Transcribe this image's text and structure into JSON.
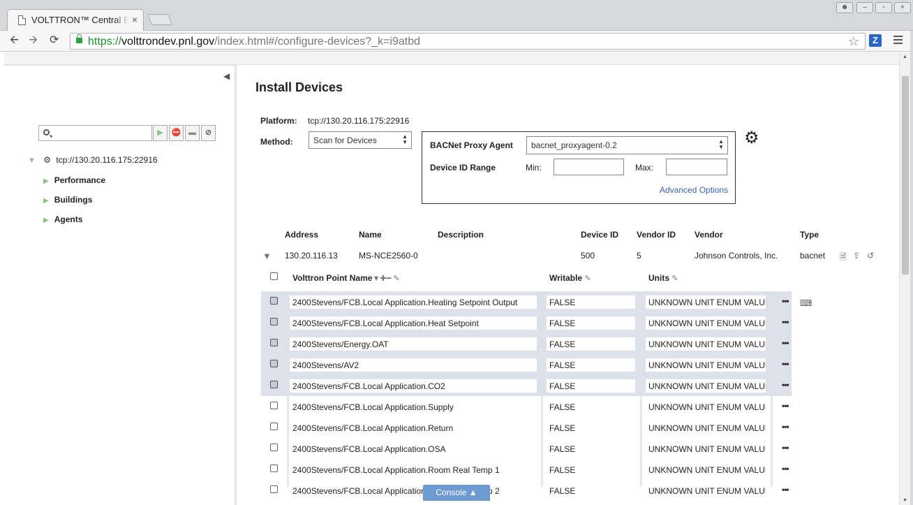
{
  "browser": {
    "tab_title": "VOLTTRON™ Central BETA",
    "url_scheme": "https://",
    "url_host": "volttrondev.pnl.gov",
    "url_path": "/index.html#/configure-devices?_k=i9atbd",
    "extension_label": "Z"
  },
  "sidebar": {
    "search_placeholder": "",
    "root_label": "tcp://130.20.116.175:22916",
    "items": [
      {
        "label": "Performance"
      },
      {
        "label": "Buildings"
      },
      {
        "label": "Agents"
      }
    ]
  },
  "main": {
    "title": "Install Devices",
    "platform_label": "Platform:",
    "platform_value": "tcp://130.20.116.175:22916",
    "method_label": "Method:",
    "method_value": "Scan for Devices",
    "proxy_label": "BACNet Proxy Agent",
    "proxy_value": "bacnet_proxyagent-0.2",
    "range_label": "Device ID Range",
    "min_label": "Min:",
    "max_label": "Max:",
    "min_value": "",
    "max_value": "",
    "advanced_label": "Advanced Options"
  },
  "devices": {
    "headers": {
      "address": "Address",
      "name": "Name",
      "description": "Description",
      "device_id": "Device ID",
      "vendor_id": "Vendor ID",
      "vendor": "Vendor",
      "type": "Type"
    },
    "row": {
      "address": "130.20.116.13",
      "name": "MS-NCE2560-0",
      "description": "",
      "device_id": "500",
      "vendor_id": "5",
      "vendor": "Johnson Controls, Inc.",
      "type": "bacnet"
    }
  },
  "points": {
    "headers": {
      "name": "Volttron Point Name",
      "writable": "Writable",
      "units": "Units"
    },
    "rows": [
      {
        "name": "2400Stevens/FCB.Local Application.Heating Setpoint Output",
        "writable": "FALSE",
        "units": "UNKNOWN UNIT ENUM VALUE",
        "selected": true
      },
      {
        "name": "2400Stevens/FCB.Local Application.Heat Setpoint",
        "writable": "FALSE",
        "units": "UNKNOWN UNIT ENUM VALUE",
        "selected": true
      },
      {
        "name": "2400Stevens/Energy.OAT",
        "writable": "FALSE",
        "units": "UNKNOWN UNIT ENUM VALUE",
        "selected": true
      },
      {
        "name": "2400Stevens/AV2",
        "writable": "FALSE",
        "units": "UNKNOWN UNIT ENUM VALUE",
        "selected": true
      },
      {
        "name": "2400Stevens/FCB.Local Application.CO2",
        "writable": "FALSE",
        "units": "UNKNOWN UNIT ENUM VALUE",
        "selected": true
      },
      {
        "name": "2400Stevens/FCB.Local Application.Supply",
        "writable": "FALSE",
        "units": "UNKNOWN UNIT ENUM VALUE",
        "selected": false
      },
      {
        "name": "2400Stevens/FCB.Local Application.Return",
        "writable": "FALSE",
        "units": "UNKNOWN UNIT ENUM VALUE",
        "selected": false
      },
      {
        "name": "2400Stevens/FCB.Local Application.OSA",
        "writable": "FALSE",
        "units": "UNKNOWN UNIT ENUM VALUE",
        "selected": false
      },
      {
        "name": "2400Stevens/FCB.Local Application.Room Real Temp 1",
        "writable": "FALSE",
        "units": "UNKNOWN UNIT ENUM VALUE",
        "selected": false
      },
      {
        "name": "2400Stevens/FCB.Local Application.Room Real Temp 2",
        "writable": "FALSE",
        "units": "UNKNOWN UNIT ENUM VALUE",
        "selected": false
      }
    ],
    "more_label": "•••"
  },
  "console": {
    "label": "Console ▲"
  },
  "colors": {
    "accent": "#3a62b3",
    "console_bg": "#6d9ad0",
    "selected_row_bg": "#dde2ea",
    "tree_arrow": "#8bc17e"
  }
}
